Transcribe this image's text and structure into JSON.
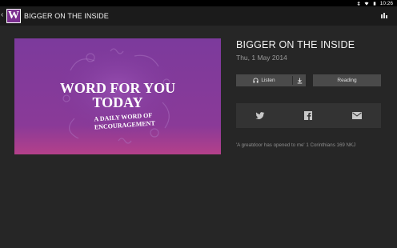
{
  "status": {
    "time": "10:26"
  },
  "appbar": {
    "title": "BIGGER ON THE INSIDE",
    "back_glyph": "‹",
    "logo_letter": "W"
  },
  "hero": {
    "line1": "WORD FOR YOU",
    "line2": "TODAY",
    "line3": "A DAILY WORD OF",
    "line4": "ENCOURAGEMENT"
  },
  "episode": {
    "title": "BIGGER ON THE INSIDE",
    "date": "Thu, 1 May 2014",
    "listen_label": "Listen",
    "reading_label": "Reading",
    "quote": "'A greatdoor has opened to me' 1 Corinthians 169 NKJ"
  },
  "icons": {
    "logo": "word-for-you-logo",
    "share": "share-icon",
    "headphones": "headphones-icon",
    "download": "download-icon",
    "twitter": "twitter-icon",
    "facebook": "facebook-icon",
    "email": "email-icon"
  },
  "colors": {
    "accent": "#7b2f8f",
    "hero_top": "#7c3a9c",
    "hero_bottom": "#b4408a"
  }
}
